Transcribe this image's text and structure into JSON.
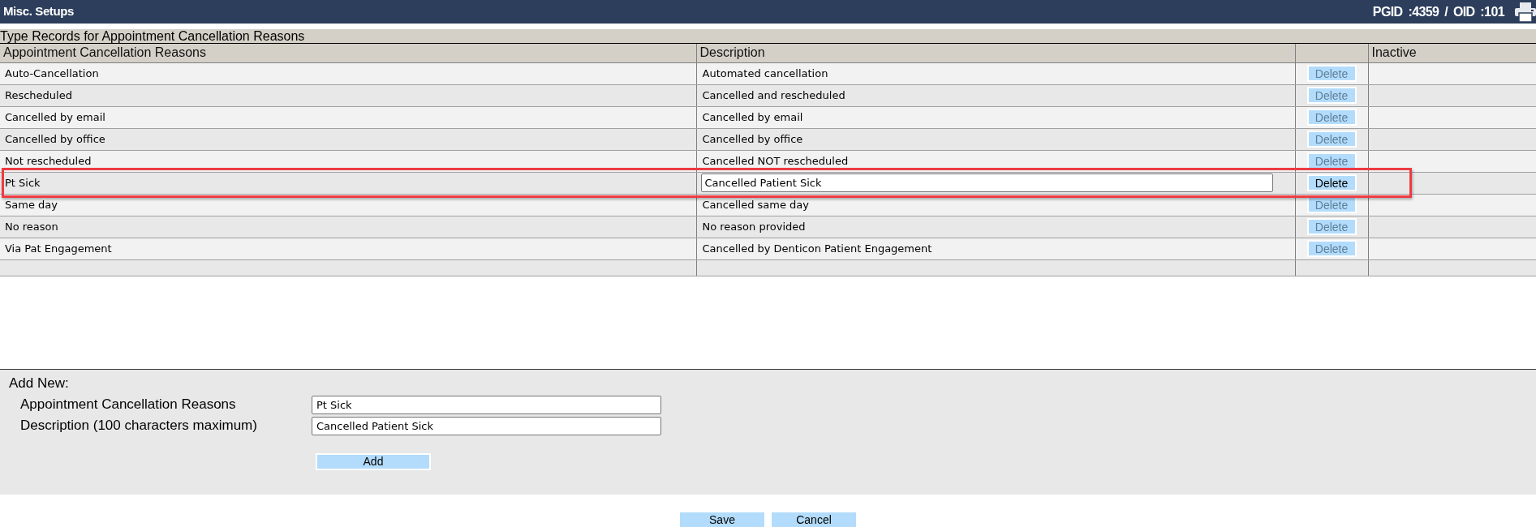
{
  "header": {
    "title": "Misc. Setups",
    "ids": "PGID :4359 / OID :101"
  },
  "section": {
    "title": "Type Records for Appointment Cancellation Reasons"
  },
  "table": {
    "columns": [
      {
        "kind": "text",
        "label": "Appointment Cancellation Reasons"
      },
      {
        "kind": "text",
        "label": "Description"
      },
      {
        "kind": "actions"
      },
      {
        "kind": "text",
        "label": "Inactive"
      }
    ],
    "rows": [
      {
        "reason": "Auto-Cancellation",
        "description": "Automated cancellation",
        "editing": false,
        "highlighted": false,
        "delete": {
          "label": "Delete",
          "disabled": true
        }
      },
      {
        "reason": "Rescheduled",
        "description": "Cancelled and rescheduled",
        "editing": false,
        "highlighted": false,
        "delete": {
          "label": "Delete",
          "disabled": true
        }
      },
      {
        "reason": "Cancelled by email",
        "description": "Cancelled by email",
        "editing": false,
        "highlighted": false,
        "delete": {
          "label": "Delete",
          "disabled": true
        }
      },
      {
        "reason": "Cancelled by office",
        "description": "Cancelled by office",
        "editing": false,
        "highlighted": false,
        "delete": {
          "label": "Delete",
          "disabled": true
        }
      },
      {
        "reason": "Not rescheduled",
        "description": "Cancelled NOT rescheduled",
        "editing": false,
        "highlighted": false,
        "delete": {
          "label": "Delete",
          "disabled": true
        }
      },
      {
        "reason": "Pt Sick",
        "description": "Cancelled Patient Sick",
        "editing": true,
        "highlighted": true,
        "delete": {
          "label": "Delete",
          "disabled": false
        }
      },
      {
        "reason": "Same day",
        "description": "Cancelled same day",
        "editing": false,
        "highlighted": false,
        "delete": {
          "label": "Delete",
          "disabled": true
        }
      },
      {
        "reason": "No reason",
        "description": "No reason provided",
        "editing": false,
        "highlighted": false,
        "delete": {
          "label": "Delete",
          "disabled": true
        }
      },
      {
        "reason": "Via Pat Engagement",
        "description": "Cancelled by Denticon Patient Engagement",
        "editing": false,
        "highlighted": false,
        "delete": {
          "label": "Delete",
          "disabled": true
        }
      }
    ]
  },
  "add_new": {
    "title": "Add New:",
    "fields": [
      {
        "label": "Appointment Cancellation Reasons",
        "value": "Pt Sick"
      },
      {
        "label": "Description (100 characters maximum)",
        "value": "Cancelled Patient Sick"
      }
    ],
    "button": "Add"
  },
  "buttons": [
    "Save",
    "Cancel"
  ]
}
